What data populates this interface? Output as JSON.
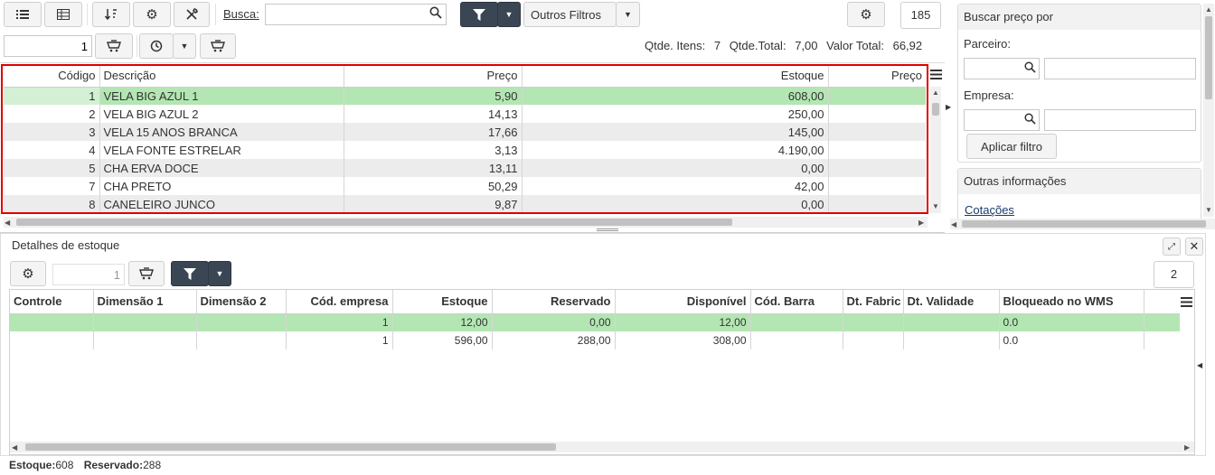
{
  "toolbar": {
    "busca_label": "Busca:",
    "busca_value": "",
    "filter_label": "Outros Filtros",
    "count_badge": "185",
    "page_value": "1"
  },
  "summary": {
    "itens_label": "Qtde. Itens:",
    "itens_value": "7",
    "total_label": "Qtde.Total:",
    "total_value": "7,00",
    "valor_label": "Valor Total:",
    "valor_value": "66,92"
  },
  "grid": {
    "headers": [
      "Código",
      "Descrição",
      "Preço",
      "Estoque",
      "Preço"
    ],
    "rows": [
      {
        "codigo": "1",
        "descricao": "VELA BIG AZUL 1",
        "preco": "5,90",
        "estoque": "608,00",
        "preco2": ""
      },
      {
        "codigo": "2",
        "descricao": "VELA BIG AZUL 2",
        "preco": "14,13",
        "estoque": "250,00",
        "preco2": ""
      },
      {
        "codigo": "3",
        "descricao": "VELA 15 ANOS BRANCA",
        "preco": "17,66",
        "estoque": "145,00",
        "preco2": ""
      },
      {
        "codigo": "4",
        "descricao": "VELA FONTE ESTRELAR",
        "preco": "3,13",
        "estoque": "4.190,00",
        "preco2": ""
      },
      {
        "codigo": "5",
        "descricao": "CHA ERVA DOCE",
        "preco": "13,11",
        "estoque": "0,00",
        "preco2": ""
      },
      {
        "codigo": "7",
        "descricao": "CHA PRETO",
        "preco": "50,29",
        "estoque": "42,00",
        "preco2": ""
      },
      {
        "codigo": "8",
        "descricao": "CANELEIRO JUNCO",
        "preco": "9,87",
        "estoque": "0,00",
        "preco2": ""
      }
    ]
  },
  "side": {
    "title": "Buscar preço por",
    "parceiro_label": "Parceiro:",
    "empresa_label": "Empresa:",
    "apply_label": "Aplicar filtro",
    "outras_title": "Outras informações",
    "cotacoes_link": "Cotações"
  },
  "details": {
    "title": "Detalhes de estoque",
    "page_value": "1",
    "count_badge": "2",
    "headers": [
      "Controle",
      "Dimensão 1",
      "Dimensão 2",
      "Cód. empresa",
      "Estoque",
      "Reservado",
      "Disponível",
      "Cód. Barra",
      "Dt. Fabric",
      "Dt. Validade",
      "Bloqueado no WMS"
    ],
    "rows": [
      [
        "",
        "",
        "",
        "1",
        "12,00",
        "0,00",
        "12,00",
        "",
        "",
        "",
        "0.0"
      ],
      [
        "",
        "",
        "",
        "1",
        "596,00",
        "288,00",
        "308,00",
        "",
        "",
        "",
        "0.0"
      ]
    ]
  },
  "footer": {
    "estoque_label": "Estoque:",
    "estoque_value": "608",
    "reservado_label": "Reservado:",
    "reservado_value": "288"
  },
  "colors": {
    "selected_row": "#b3e6b3",
    "highlight_border": "#e00000",
    "dark_button": "#3b4654"
  }
}
